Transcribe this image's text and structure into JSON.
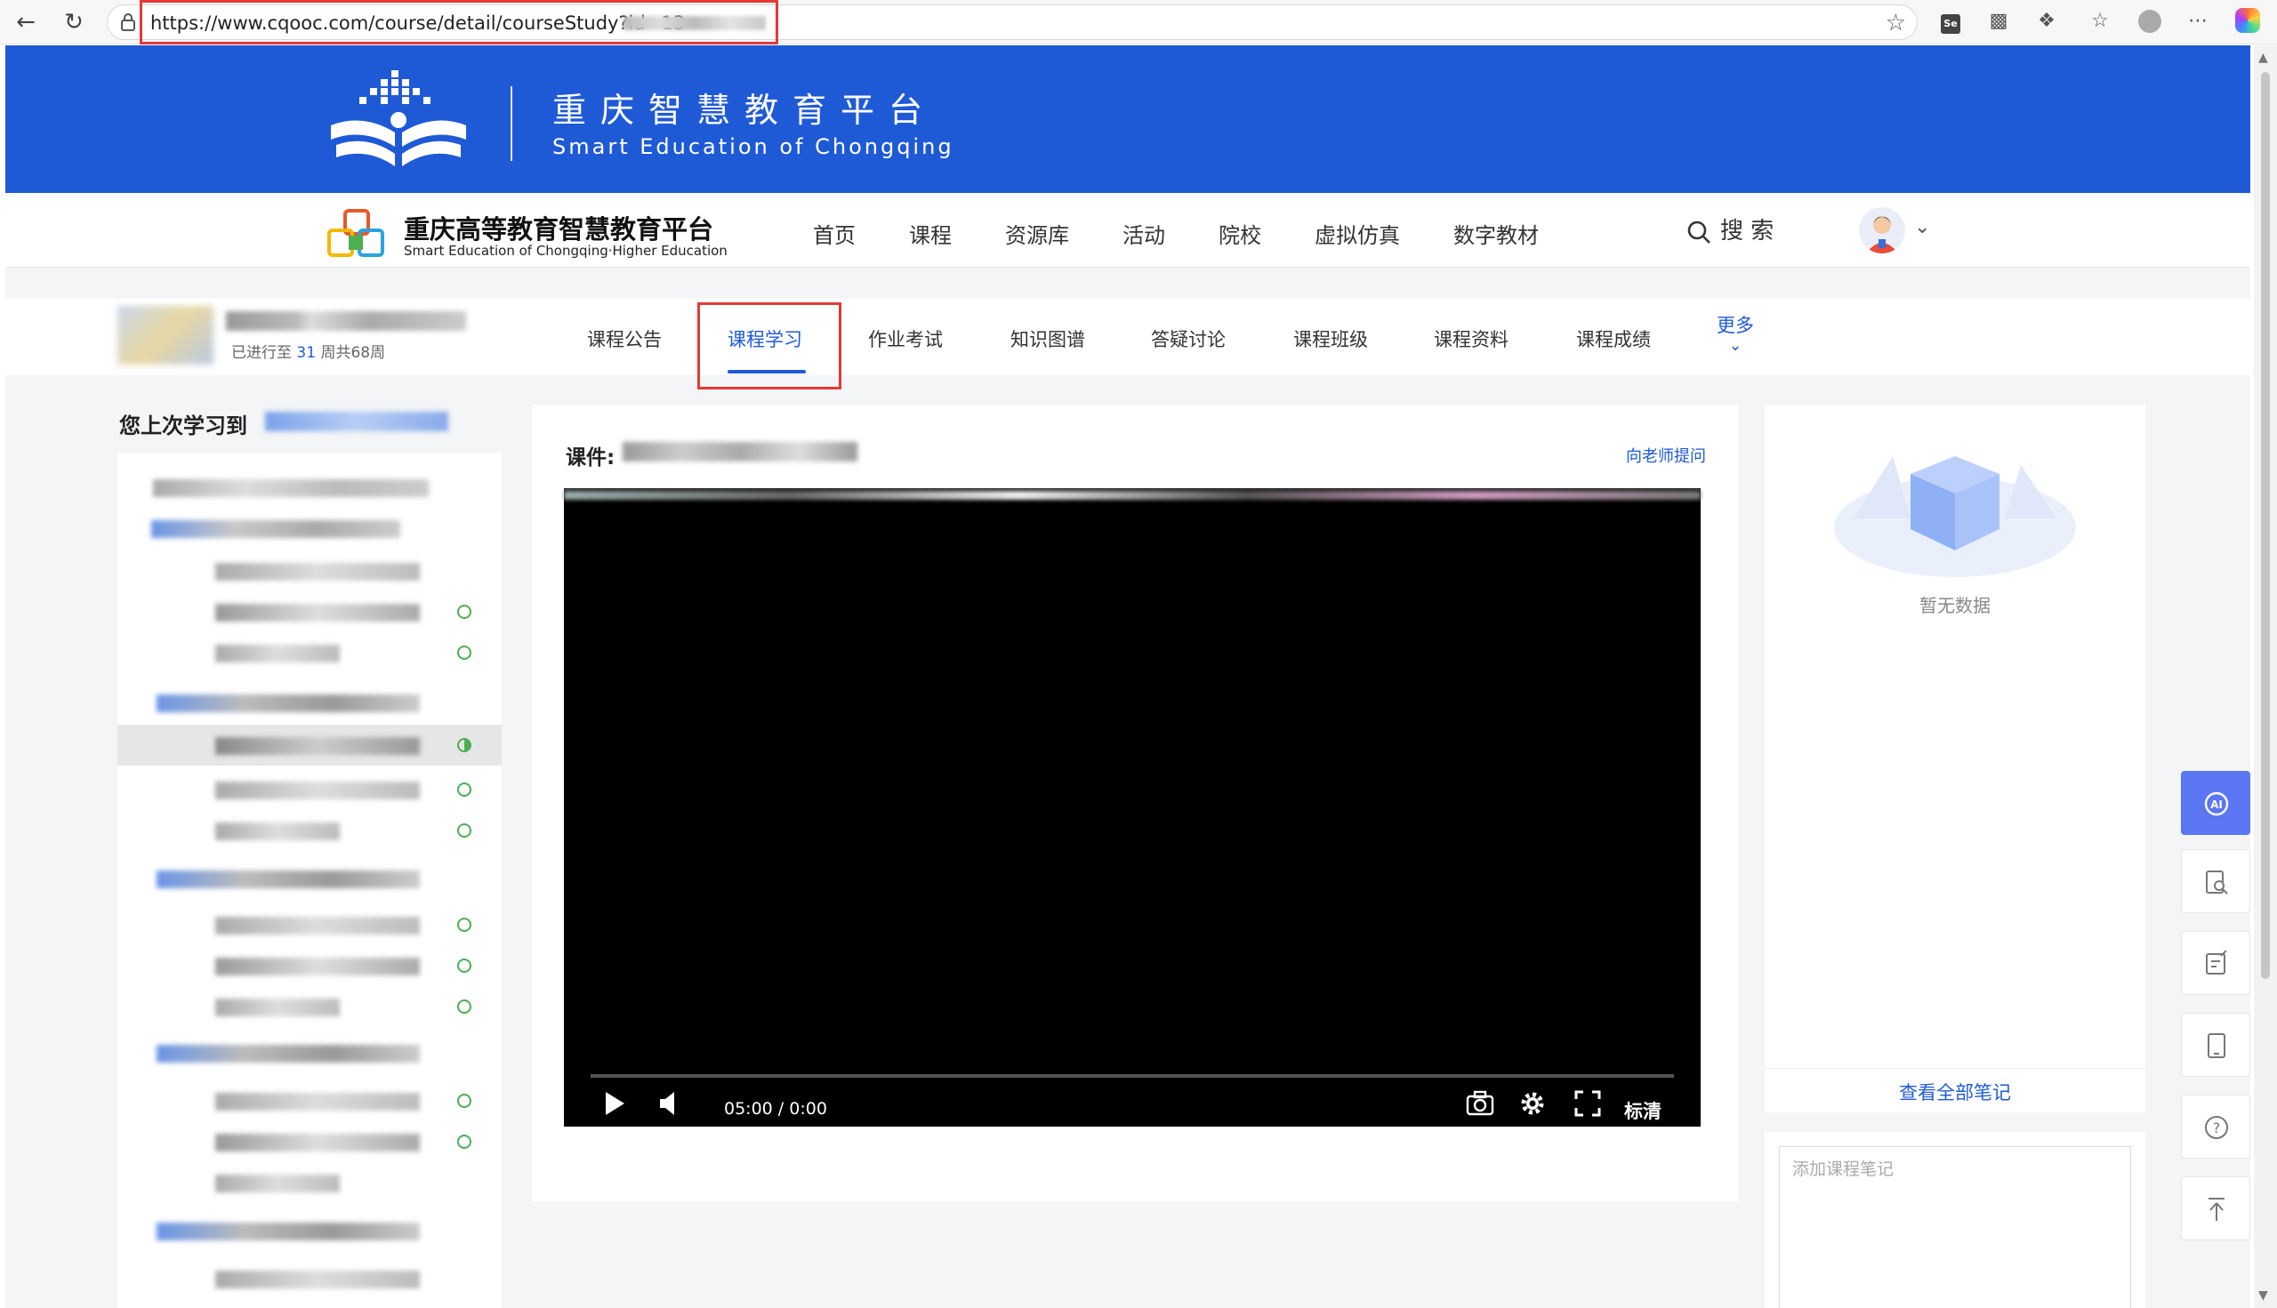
{
  "browser": {
    "url": "https://www.cqooc.com/course/detail/courseStudy?id=13"
  },
  "banner": {
    "title_cn": "重庆智慧教育平台",
    "title_en": "Smart Education of Chongqing"
  },
  "platform": {
    "name": "重庆高等教育智慧教育平台",
    "name_en": "Smart Education of Chongqing·Higher Education"
  },
  "nav": {
    "items": [
      "首页",
      "课程",
      "资源库",
      "活动",
      "院校",
      "虚拟仿真",
      "数字教材"
    ],
    "search_label": "搜 索"
  },
  "course": {
    "progress_prefix": "已进行至 ",
    "progress_week": "31",
    "progress_suffix": " 周共68周",
    "tabs": [
      "课程公告",
      "课程学习",
      "作业考试",
      "知识图谱",
      "答疑讨论",
      "课程班级",
      "课程资料",
      "课程成绩"
    ],
    "active_tab": "课程学习",
    "more_label": "更多"
  },
  "sidebar": {
    "last_studied_label": "您上次学习到"
  },
  "lesson": {
    "label": "课件:",
    "ask_teacher": "向老师提问"
  },
  "player": {
    "time": "05:00 / 0:00",
    "quality": "标清",
    "progress": 0
  },
  "notes": {
    "empty_text": "暂无数据",
    "view_all": "查看全部笔记",
    "placeholder": "添加课程笔记"
  },
  "colors": {
    "brand_blue": "#1f5ad6",
    "highlight_red": "#e53935",
    "done_green": "#4caf50",
    "ai_button": "#5a76f2"
  }
}
